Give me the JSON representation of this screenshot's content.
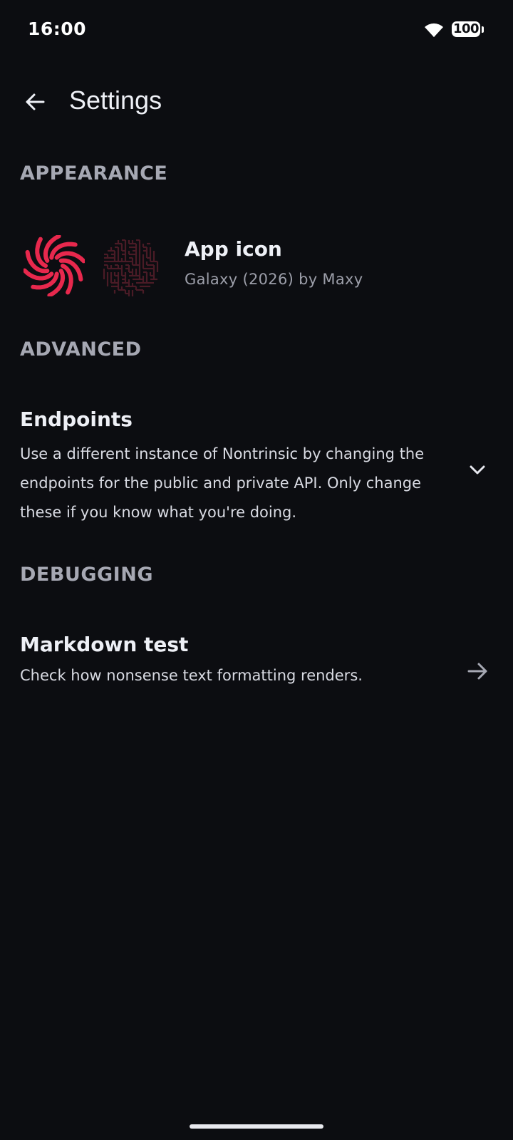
{
  "status": {
    "time": "16:00",
    "battery": "100"
  },
  "header": {
    "title": "Settings"
  },
  "sections": {
    "appearance": {
      "title": "APPEARANCE",
      "app_icon": {
        "title": "App icon",
        "subtitle": "Galaxy (2026) by Maxy"
      }
    },
    "advanced": {
      "title": "ADVANCED",
      "endpoints": {
        "title": "Endpoints",
        "description": "Use a different instance of Nontrinsic by changing the endpoints for the public and private API. Only change these if you know what you're doing."
      }
    },
    "debugging": {
      "title": "DEBUGGING",
      "markdown": {
        "title": "Markdown test",
        "description": "Check how nonsense text formatting renders."
      }
    }
  },
  "colors": {
    "background": "#0c0d11",
    "accent": "#e8284d",
    "maze": "#4a1b26"
  },
  "icons": [
    "wifi-icon",
    "back-arrow-icon",
    "galaxy-icon",
    "maze-icon",
    "chevron-down-icon",
    "arrow-right-icon"
  ]
}
